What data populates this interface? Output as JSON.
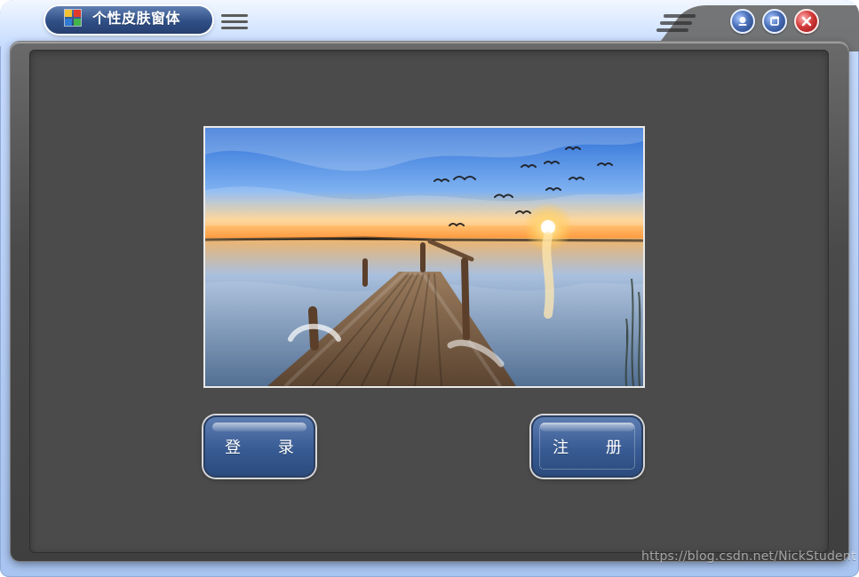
{
  "window": {
    "title": "个性皮肤窗体"
  },
  "titlebar": {
    "menu_icon": "hamburger-menu-icon",
    "controls": {
      "minimize_icon": "minimize-icon",
      "restore_icon": "restore-icon",
      "close_icon": "close-icon"
    }
  },
  "content": {
    "image_alt_hint": "",
    "buttons": {
      "login_label": "登 录",
      "register_label": "注 册"
    }
  },
  "watermark": {
    "text": "https://blog.csdn.net/NickStudent"
  },
  "colors": {
    "titlebar_pill": "#2f4f86",
    "close_red": "#d53b3b",
    "panel_bg": "#4b4b4b",
    "button_blue": "#385b94"
  }
}
